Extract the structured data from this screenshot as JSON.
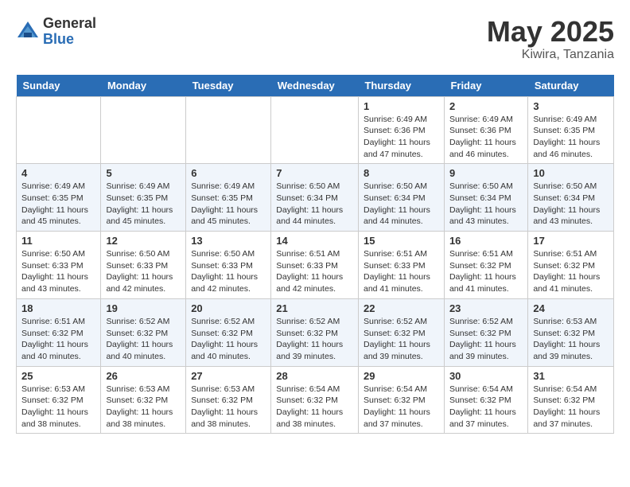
{
  "logo": {
    "general": "General",
    "blue": "Blue"
  },
  "title": "May 2025",
  "location": "Kiwira, Tanzania",
  "days_of_week": [
    "Sunday",
    "Monday",
    "Tuesday",
    "Wednesday",
    "Thursday",
    "Friday",
    "Saturday"
  ],
  "weeks": [
    [
      {
        "day": "",
        "info": ""
      },
      {
        "day": "",
        "info": ""
      },
      {
        "day": "",
        "info": ""
      },
      {
        "day": "",
        "info": ""
      },
      {
        "day": "1",
        "info": "Sunrise: 6:49 AM\nSunset: 6:36 PM\nDaylight: 11 hours and 47 minutes."
      },
      {
        "day": "2",
        "info": "Sunrise: 6:49 AM\nSunset: 6:36 PM\nDaylight: 11 hours and 46 minutes."
      },
      {
        "day": "3",
        "info": "Sunrise: 6:49 AM\nSunset: 6:35 PM\nDaylight: 11 hours and 46 minutes."
      }
    ],
    [
      {
        "day": "4",
        "info": "Sunrise: 6:49 AM\nSunset: 6:35 PM\nDaylight: 11 hours and 45 minutes."
      },
      {
        "day": "5",
        "info": "Sunrise: 6:49 AM\nSunset: 6:35 PM\nDaylight: 11 hours and 45 minutes."
      },
      {
        "day": "6",
        "info": "Sunrise: 6:49 AM\nSunset: 6:35 PM\nDaylight: 11 hours and 45 minutes."
      },
      {
        "day": "7",
        "info": "Sunrise: 6:50 AM\nSunset: 6:34 PM\nDaylight: 11 hours and 44 minutes."
      },
      {
        "day": "8",
        "info": "Sunrise: 6:50 AM\nSunset: 6:34 PM\nDaylight: 11 hours and 44 minutes."
      },
      {
        "day": "9",
        "info": "Sunrise: 6:50 AM\nSunset: 6:34 PM\nDaylight: 11 hours and 43 minutes."
      },
      {
        "day": "10",
        "info": "Sunrise: 6:50 AM\nSunset: 6:34 PM\nDaylight: 11 hours and 43 minutes."
      }
    ],
    [
      {
        "day": "11",
        "info": "Sunrise: 6:50 AM\nSunset: 6:33 PM\nDaylight: 11 hours and 43 minutes."
      },
      {
        "day": "12",
        "info": "Sunrise: 6:50 AM\nSunset: 6:33 PM\nDaylight: 11 hours and 42 minutes."
      },
      {
        "day": "13",
        "info": "Sunrise: 6:50 AM\nSunset: 6:33 PM\nDaylight: 11 hours and 42 minutes."
      },
      {
        "day": "14",
        "info": "Sunrise: 6:51 AM\nSunset: 6:33 PM\nDaylight: 11 hours and 42 minutes."
      },
      {
        "day": "15",
        "info": "Sunrise: 6:51 AM\nSunset: 6:33 PM\nDaylight: 11 hours and 41 minutes."
      },
      {
        "day": "16",
        "info": "Sunrise: 6:51 AM\nSunset: 6:32 PM\nDaylight: 11 hours and 41 minutes."
      },
      {
        "day": "17",
        "info": "Sunrise: 6:51 AM\nSunset: 6:32 PM\nDaylight: 11 hours and 41 minutes."
      }
    ],
    [
      {
        "day": "18",
        "info": "Sunrise: 6:51 AM\nSunset: 6:32 PM\nDaylight: 11 hours and 40 minutes."
      },
      {
        "day": "19",
        "info": "Sunrise: 6:52 AM\nSunset: 6:32 PM\nDaylight: 11 hours and 40 minutes."
      },
      {
        "day": "20",
        "info": "Sunrise: 6:52 AM\nSunset: 6:32 PM\nDaylight: 11 hours and 40 minutes."
      },
      {
        "day": "21",
        "info": "Sunrise: 6:52 AM\nSunset: 6:32 PM\nDaylight: 11 hours and 39 minutes."
      },
      {
        "day": "22",
        "info": "Sunrise: 6:52 AM\nSunset: 6:32 PM\nDaylight: 11 hours and 39 minutes."
      },
      {
        "day": "23",
        "info": "Sunrise: 6:52 AM\nSunset: 6:32 PM\nDaylight: 11 hours and 39 minutes."
      },
      {
        "day": "24",
        "info": "Sunrise: 6:53 AM\nSunset: 6:32 PM\nDaylight: 11 hours and 39 minutes."
      }
    ],
    [
      {
        "day": "25",
        "info": "Sunrise: 6:53 AM\nSunset: 6:32 PM\nDaylight: 11 hours and 38 minutes."
      },
      {
        "day": "26",
        "info": "Sunrise: 6:53 AM\nSunset: 6:32 PM\nDaylight: 11 hours and 38 minutes."
      },
      {
        "day": "27",
        "info": "Sunrise: 6:53 AM\nSunset: 6:32 PM\nDaylight: 11 hours and 38 minutes."
      },
      {
        "day": "28",
        "info": "Sunrise: 6:54 AM\nSunset: 6:32 PM\nDaylight: 11 hours and 38 minutes."
      },
      {
        "day": "29",
        "info": "Sunrise: 6:54 AM\nSunset: 6:32 PM\nDaylight: 11 hours and 37 minutes."
      },
      {
        "day": "30",
        "info": "Sunrise: 6:54 AM\nSunset: 6:32 PM\nDaylight: 11 hours and 37 minutes."
      },
      {
        "day": "31",
        "info": "Sunrise: 6:54 AM\nSunset: 6:32 PM\nDaylight: 11 hours and 37 minutes."
      }
    ]
  ]
}
